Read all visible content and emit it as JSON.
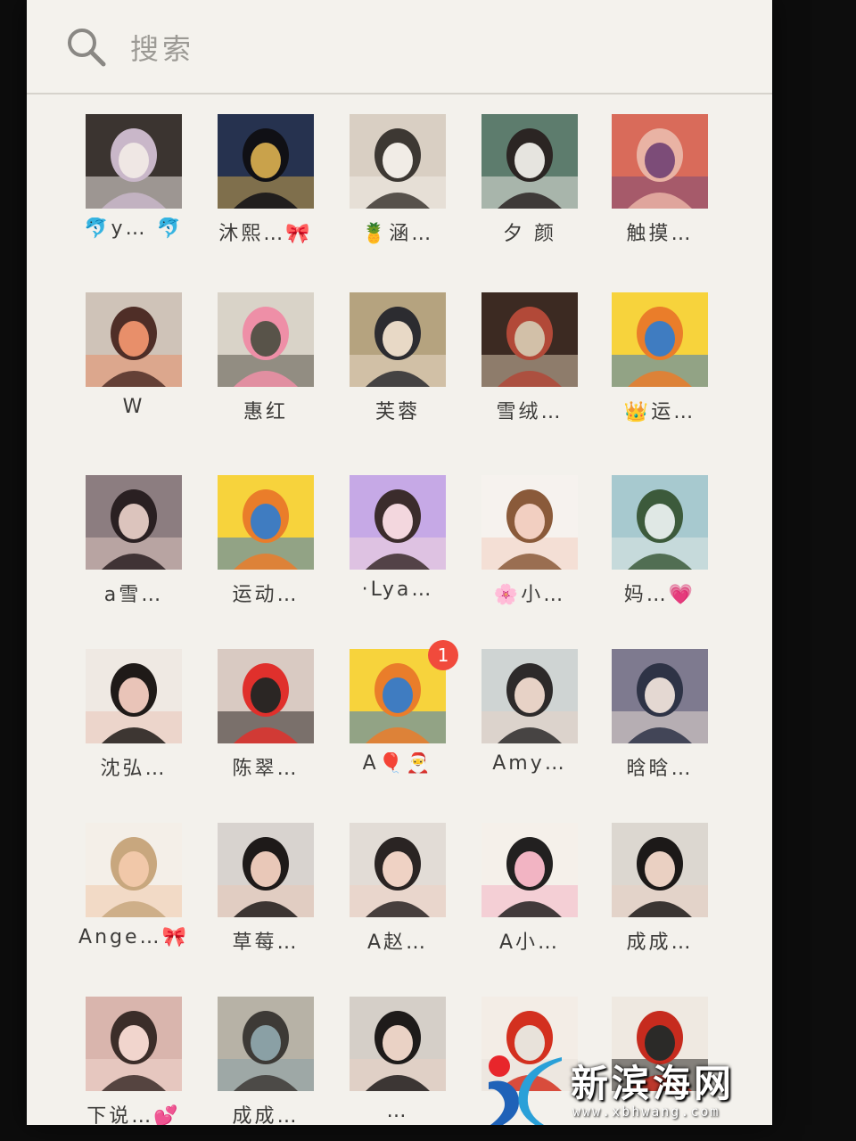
{
  "search": {
    "placeholder": "搜索"
  },
  "contacts": [
    {
      "name": "🐬y… 🐬",
      "palette": [
        "#3b3430",
        "#c9b7c9",
        "#efe7e4"
      ]
    },
    {
      "name": "沐熙…🎀",
      "palette": [
        "#26324f",
        "#101015",
        "#c9a24b"
      ]
    },
    {
      "name": "🍍涵…",
      "palette": [
        "#d9cfc3",
        "#3d3833",
        "#f1ece6"
      ]
    },
    {
      "name": "夕 颜",
      "palette": [
        "#5d7c6d",
        "#2b2523",
        "#e6e4df"
      ]
    },
    {
      "name": "触摸…",
      "palette": [
        "#d96b5a",
        "#e9b3a4",
        "#7c4c78"
      ]
    },
    {
      "name": "W",
      "palette": [
        "#cfc3b8",
        "#4f2e27",
        "#e88f6a"
      ]
    },
    {
      "name": "惠红",
      "palette": [
        "#d9d3c8",
        "#ee8fa7",
        "#585349"
      ]
    },
    {
      "name": "芙蓉",
      "palette": [
        "#b5a37f",
        "#2c2c30",
        "#e8d9c6"
      ]
    },
    {
      "name": "雪绒…",
      "palette": [
        "#3c2a22",
        "#b24938",
        "#d2c0a8"
      ]
    },
    {
      "name": "👑运…",
      "palette": [
        "#f7d33c",
        "#ea7d2a",
        "#3f7cc1"
      ]
    },
    {
      "name": "a雪…",
      "palette": [
        "#8c7d80",
        "#2a2022",
        "#dcc4bd"
      ]
    },
    {
      "name": "运动…",
      "palette": [
        "#f7d33c",
        "#ea7d2a",
        "#3f7cc1"
      ]
    },
    {
      "name": "·Lya…",
      "palette": [
        "#c6a9e6",
        "#3b2c2c",
        "#f3d7de"
      ]
    },
    {
      "name": "🌸小…",
      "palette": [
        "#f6f2ee",
        "#8a5a3a",
        "#f2cfc1"
      ]
    },
    {
      "name": "妈…💗",
      "palette": [
        "#a7c9cf",
        "#3c5a3b",
        "#e0e8e5"
      ]
    },
    {
      "name": "沈弘…",
      "palette": [
        "#efe9e3",
        "#1f1a18",
        "#e9c4b8"
      ]
    },
    {
      "name": "陈翠…",
      "palette": [
        "#d9cac2",
        "#e0302c",
        "#2b2624"
      ]
    },
    {
      "name": "A🎈🎅",
      "palette": [
        "#f7d33c",
        "#ea7d2a",
        "#3f7cc1"
      ],
      "badge": "1"
    },
    {
      "name": "Amy…",
      "palette": [
        "#cfd4d3",
        "#2d2a2a",
        "#e7d2c6"
      ]
    },
    {
      "name": "晗晗…",
      "palette": [
        "#7e7a8f",
        "#2e3346",
        "#e4d8d2"
      ]
    },
    {
      "name": "Ange…🎀",
      "palette": [
        "#f4efe8",
        "#c8a77e",
        "#f1c8a9"
      ]
    },
    {
      "name": "草莓…",
      "palette": [
        "#d8d3cf",
        "#1e1a19",
        "#e9c8b8"
      ]
    },
    {
      "name": "A赵…",
      "palette": [
        "#e2dcd6",
        "#2a2423",
        "#efd2c4"
      ]
    },
    {
      "name": "A小…",
      "palette": [
        "#f5f0ea",
        "#222020",
        "#f2b4c3"
      ]
    },
    {
      "name": "成成…",
      "palette": [
        "#dcd7d0",
        "#1c1918",
        "#ead0c2"
      ]
    },
    {
      "name": "下说…💕",
      "palette": [
        "#d9b5ad",
        "#3b2d29",
        "#f1d5cd"
      ]
    },
    {
      "name": "成成…",
      "palette": [
        "#b7b2a6",
        "#3d3a36",
        "#8aa0a5"
      ]
    },
    {
      "name": "…",
      "palette": [
        "#d5cfc8",
        "#1e1b1a",
        "#ead2c5"
      ]
    },
    {
      "name": "",
      "palette": [
        "#f3ede6",
        "#d3301f",
        "#e8e2da"
      ]
    },
    {
      "name": "",
      "palette": [
        "#efe9e1",
        "#c62b1e",
        "#2b2a28"
      ]
    }
  ],
  "watermark": {
    "text": "新滨海网",
    "url": "www.xbhwang.com"
  },
  "colors": {
    "background": "#f3f1ec",
    "text": "#3c3b39",
    "badge": "#f14a3c"
  }
}
